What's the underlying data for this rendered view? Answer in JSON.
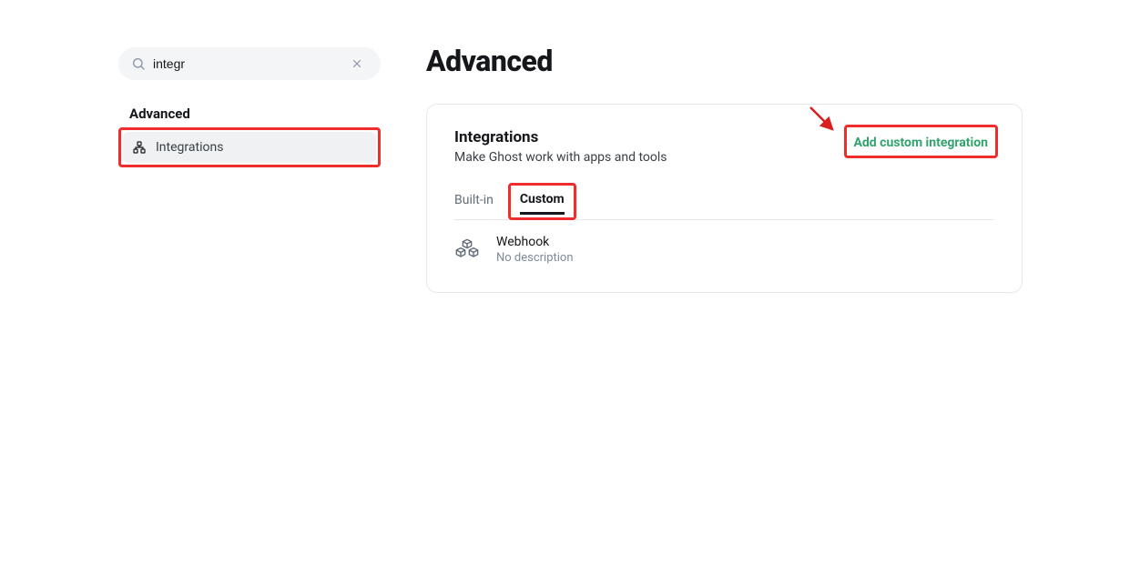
{
  "sidebar": {
    "search": {
      "value": "integr"
    },
    "section_heading": "Advanced",
    "items": [
      {
        "label": "Integrations"
      }
    ]
  },
  "page": {
    "title": "Advanced"
  },
  "integrations_card": {
    "title": "Integrations",
    "subtitle": "Make Ghost work with apps and tools",
    "add_label": "Add custom integration",
    "tabs": {
      "builtin": "Built-in",
      "custom": "Custom"
    },
    "items": [
      {
        "name": "Webhook",
        "description": "No description"
      }
    ]
  }
}
